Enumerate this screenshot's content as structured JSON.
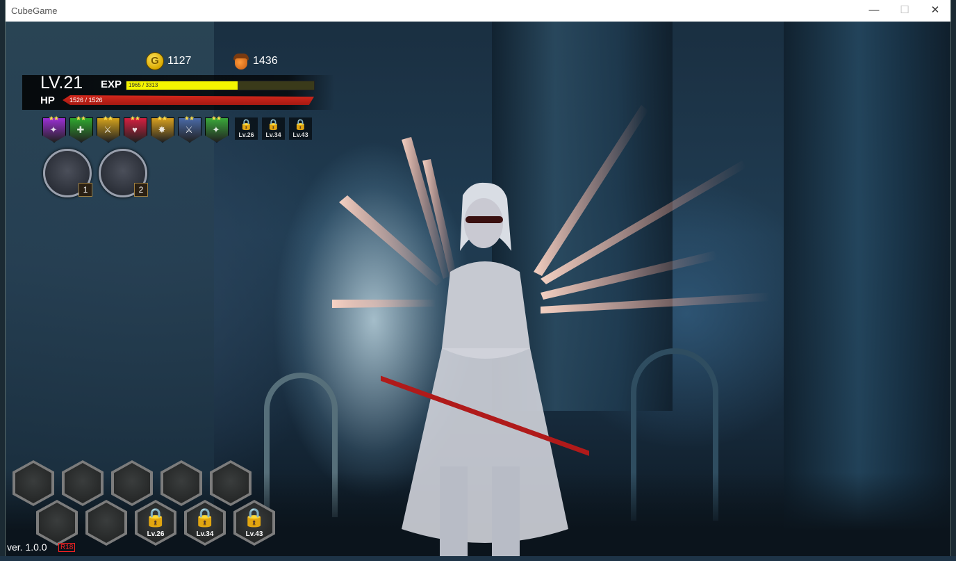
{
  "window": {
    "title": "CubeGame",
    "controls": {
      "minimize": "—",
      "maximize": "☐",
      "close": "✕"
    }
  },
  "hud": {
    "gold": {
      "icon": "gold-coin-icon",
      "coin_letter": "G",
      "value": "1127"
    },
    "acorns": {
      "icon": "acorn-icon",
      "value": "1436"
    },
    "level": "LV.21",
    "exp": {
      "label": "EXP",
      "text": "1965 / 3313",
      "current": 1965,
      "max": 3313
    },
    "hp": {
      "label": "HP",
      "text": "1526 / 1526",
      "current": 1526,
      "max": 1526
    },
    "badges": [
      {
        "icon": "purple-gem-badge-icon",
        "color": "#9b2fd4",
        "stars": "★★",
        "glyph": "✦"
      },
      {
        "icon": "green-badge-icon",
        "color": "#2fa82f",
        "stars": "★★",
        "glyph": "✚"
      },
      {
        "icon": "gold-sword-badge-icon",
        "color": "#d4a21c",
        "stars": "★★",
        "glyph": "⚔"
      },
      {
        "icon": "red-heart-badge-icon",
        "color": "#d42040",
        "stars": "★★",
        "glyph": "♥"
      },
      {
        "icon": "gold-burst-badge-icon",
        "color": "#d8a020",
        "stars": "★★",
        "glyph": "✸"
      },
      {
        "icon": "blue-sword-badge-icon",
        "color": "#4a6aa8",
        "stars": "★★",
        "glyph": "⚔"
      },
      {
        "icon": "green-star-badge-icon",
        "color": "#3aa83a",
        "stars": "★★",
        "glyph": "✦"
      }
    ],
    "locked_badges": [
      {
        "lock": "🔒",
        "level": "Lv.26"
      },
      {
        "lock": "🔒",
        "level": "Lv.34"
      },
      {
        "lock": "🔒",
        "level": "Lv.43"
      }
    ],
    "skill_slots": [
      {
        "number": "1"
      },
      {
        "number": "2"
      }
    ],
    "hex_row1": [
      {},
      {},
      {},
      {},
      {}
    ],
    "hex_row2": [
      {
        "locked": false
      },
      {
        "locked": false
      },
      {
        "locked": true,
        "lock": "🔒",
        "level": "Lv.26"
      },
      {
        "locked": true,
        "lock": "🔒",
        "level": "Lv.34"
      },
      {
        "locked": true,
        "lock": "🔒",
        "level": "Lv.43"
      }
    ],
    "version": "ver. 1.0.0",
    "age_rating": "R18"
  },
  "colors": {
    "exp": "#f5f500",
    "hp": "#c8221a",
    "gold": "#ffd23a"
  }
}
